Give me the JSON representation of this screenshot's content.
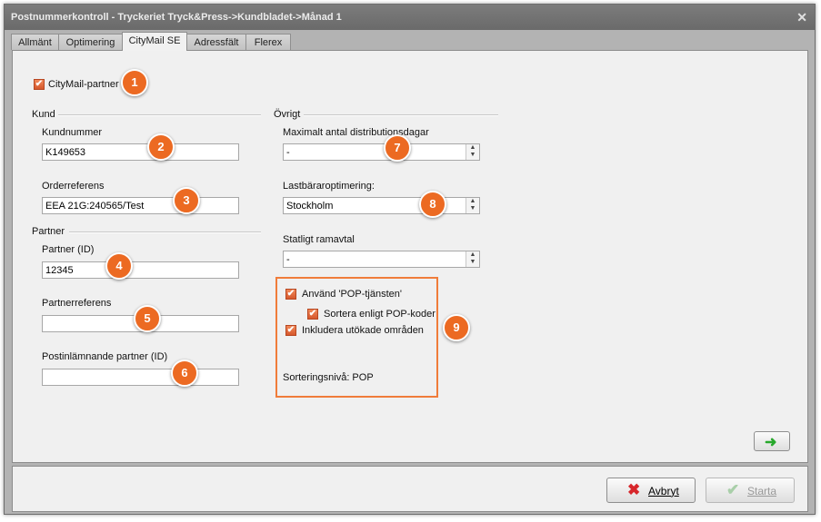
{
  "window": {
    "title": "Postnummerkontroll - Tryckeriet Tryck&Press->Kundbladet->Månad 1",
    "close_icon": "close-icon"
  },
  "tabs": [
    {
      "label": "Allmänt"
    },
    {
      "label": "Optimering"
    },
    {
      "label": "CityMail SE",
      "active": true
    },
    {
      "label": "Adressfält"
    },
    {
      "label": "Flerex"
    }
  ],
  "citymail_partner": {
    "label": "CityMail-partner",
    "checked": true
  },
  "kund": {
    "group_label": "Kund",
    "kundnummer": {
      "label": "Kundnummer",
      "value": "K149653"
    },
    "orderreferens": {
      "label": "Orderreferens",
      "value": "EEA 21G:240565/Test"
    }
  },
  "partner": {
    "group_label": "Partner",
    "partner_id": {
      "label": "Partner (ID)",
      "value": "12345"
    },
    "partnerreferens": {
      "label": "Partnerreferens",
      "value": ""
    },
    "postinlamnande": {
      "label": "Postinlämnande partner (ID)",
      "value": ""
    }
  },
  "ovrigt": {
    "group_label": "Övrigt",
    "max_dagar": {
      "label": "Maximalt antal distributionsdagar",
      "value": "-"
    },
    "lastbarar": {
      "label": "Lastbäraroptimering:",
      "value": "Stockholm"
    },
    "ramavtal": {
      "label": "Statligt ramavtal",
      "value": "-"
    }
  },
  "pop": {
    "anvand": {
      "label": "Använd 'POP-tjänsten'",
      "checked": true
    },
    "sortera": {
      "label": "Sortera enligt POP-koder",
      "checked": true
    },
    "inkludera": {
      "label": "Inkludera utökade områden",
      "checked": true
    },
    "sorteringsniva": "Sorteringsnivå: POP"
  },
  "badges": [
    "1",
    "2",
    "3",
    "4",
    "5",
    "6",
    "7",
    "8",
    "9"
  ],
  "buttons": {
    "next_icon": "arrow-right-icon",
    "avbryt": {
      "label": "Avbryt",
      "icon": "x-icon"
    },
    "starta": {
      "label": "Starta",
      "icon": "check-icon",
      "disabled": true
    }
  },
  "colors": {
    "accent": "#ec6a22",
    "titlebar": "#747474",
    "panel": "#f0f0f0"
  }
}
